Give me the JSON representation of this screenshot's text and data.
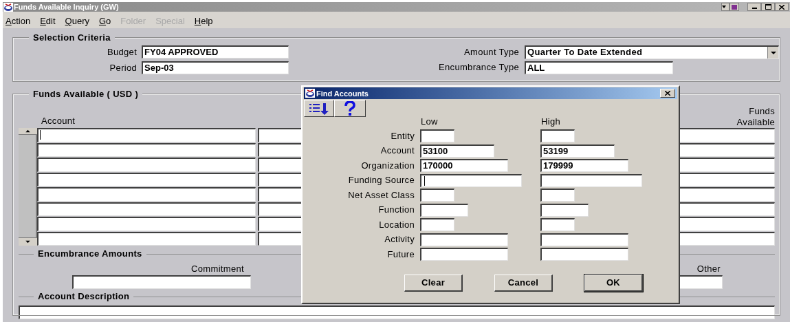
{
  "window": {
    "title": "Funds Available Inquiry (GW)"
  },
  "menu": [
    {
      "label": "Action",
      "disabled": false
    },
    {
      "label": "Edit",
      "disabled": false
    },
    {
      "label": "Query",
      "disabled": false
    },
    {
      "label": "Go",
      "disabled": false
    },
    {
      "label": "Folder",
      "disabled": true
    },
    {
      "label": "Special",
      "disabled": true
    },
    {
      "label": "Help",
      "disabled": false
    }
  ],
  "selection_criteria": {
    "title": "Selection Criteria",
    "budget": {
      "label": "Budget",
      "value": "FY04 APPROVED"
    },
    "period": {
      "label": "Period",
      "value": "Sep-03"
    },
    "amount_type": {
      "label": "Amount Type",
      "value": "Quarter To Date Extended"
    },
    "encumbrance_type": {
      "label": "Encumbrance Type",
      "value": "ALL"
    }
  },
  "funds_available": {
    "title": "Funds Available ( USD )",
    "columns": [
      "Account",
      "Funds Available"
    ],
    "rows": [
      {
        "focused": true
      },
      {
        "focused": false
      },
      {
        "focused": false
      },
      {
        "focused": false
      },
      {
        "focused": false
      },
      {
        "focused": false
      },
      {
        "focused": false
      },
      {
        "focused": false
      }
    ]
  },
  "encumbrance_amounts": {
    "title": "Encumbrance Amounts",
    "columns": [
      "Commitment",
      "Other"
    ]
  },
  "account_description": {
    "title": "Account Description"
  },
  "dialog": {
    "title": "Find Accounts",
    "toolbar": [
      {
        "kind": "sort"
      },
      {
        "kind": "help"
      }
    ],
    "column_headers": [
      "Low",
      "High"
    ],
    "rows": [
      {
        "label": "Entity",
        "low_focused": false
      },
      {
        "label": "Account",
        "low": "53100",
        "high": "53199",
        "low_focused": false
      },
      {
        "label": "Organization",
        "low": "170000",
        "high": "179999",
        "low_focused": false
      },
      {
        "label": "Funding Source",
        "low_focused": true
      },
      {
        "label": "Net Asset Class",
        "low_focused": false
      },
      {
        "label": "Function",
        "low_focused": false
      },
      {
        "label": "Location",
        "low_focused": false
      },
      {
        "label": "Activity",
        "low_focused": false
      },
      {
        "label": "Future",
        "low_focused": false
      }
    ],
    "buttons": [
      "Clear",
      "Cancel",
      "OK"
    ]
  }
}
